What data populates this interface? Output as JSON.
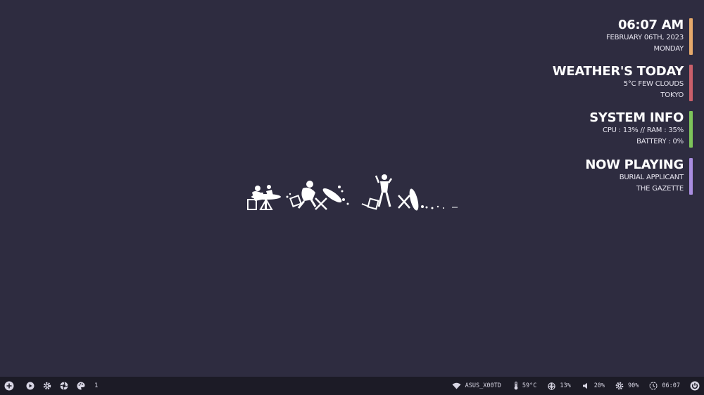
{
  "widgets": {
    "clock": {
      "title": "06:07 AM",
      "line1": "FEBRUARY 06TH, 2023",
      "line2": "MONDAY",
      "accent": "#e5a96b"
    },
    "weather": {
      "title": "WEATHER'S TODAY",
      "line1": "5°C FEW CLOUDS",
      "line2": "TOKYO",
      "accent": "#c95f6a"
    },
    "system": {
      "title": "SYSTEM INFO",
      "line1": "CPU : 13% // RAM : 35%",
      "line2": "BATTERY : 0%",
      "accent": "#7dc45a"
    },
    "music": {
      "title": "NOW PLAYING",
      "line1": "BURIAL APPLICANT",
      "line2": "THE GAZETTE",
      "accent": "#a98de0"
    }
  },
  "taskbar": {
    "workspace": "1",
    "wifi": "ASUS_X00TD",
    "temp": "59°C",
    "cpu": "13%",
    "volume": "20%",
    "brightness": "90%",
    "time": "06:07",
    "icons": {
      "launcher": "plus-circle-icon",
      "play": "play-icon",
      "settings": "gear-icon",
      "screenshot": "aperture-icon",
      "theme": "palette-icon",
      "wifi": "wifi-icon",
      "temp": "thermometer-icon",
      "cpu": "cpu-icon",
      "volume": "speaker-icon",
      "brightness": "sun-icon",
      "clock": "clock-icon",
      "power": "power-icon"
    }
  }
}
